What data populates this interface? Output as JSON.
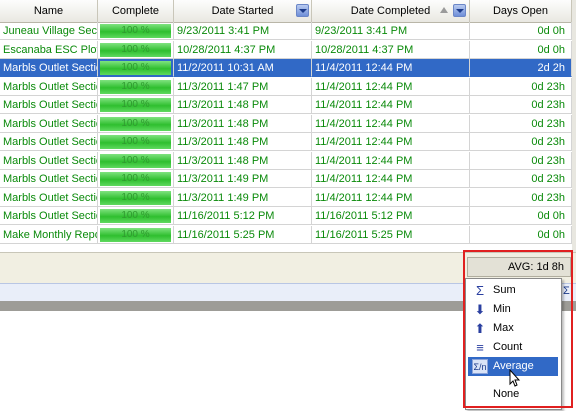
{
  "columns": [
    {
      "label": "Name"
    },
    {
      "label": "Complete"
    },
    {
      "label": "Date Started"
    },
    {
      "label": "Date Completed"
    },
    {
      "label": "Days Open"
    }
  ],
  "rows": [
    {
      "name": "Juneau Village Sect",
      "complete": "100 %",
      "started": "9/23/2011 3:41 PM",
      "completed": "9/23/2011 3:41 PM",
      "days_open": "0d 0h"
    },
    {
      "name": "Escanaba ESC Plot",
      "complete": "100 %",
      "started": "10/28/2011 4:37 PM",
      "completed": "10/28/2011 4:37 PM",
      "days_open": "0d 0h"
    },
    {
      "name": "Marbls Outlet Sectio",
      "complete": "100 %",
      "started": "11/2/2011 10:31 AM",
      "completed": "11/4/2011 12:44 PM",
      "days_open": "2d 2h",
      "selected": true
    },
    {
      "name": "Marbls Outlet Sectio",
      "complete": "100 %",
      "started": "11/3/2011 1:47 PM",
      "completed": "11/4/2011 12:44 PM",
      "days_open": "0d 23h"
    },
    {
      "name": "Marbls Outlet Sectio",
      "complete": "100 %",
      "started": "11/3/2011 1:48 PM",
      "completed": "11/4/2011 12:44 PM",
      "days_open": "0d 23h"
    },
    {
      "name": "Marbls Outlet Sectio",
      "complete": "100 %",
      "started": "11/3/2011 1:48 PM",
      "completed": "11/4/2011 12:44 PM",
      "days_open": "0d 23h"
    },
    {
      "name": "Marbls Outlet Sectio",
      "complete": "100 %",
      "started": "11/3/2011 1:48 PM",
      "completed": "11/4/2011 12:44 PM",
      "days_open": "0d 23h"
    },
    {
      "name": "Marbls Outlet Sectio",
      "complete": "100 %",
      "started": "11/3/2011 1:48 PM",
      "completed": "11/4/2011 12:44 PM",
      "days_open": "0d 23h"
    },
    {
      "name": "Marbls Outlet Sectio",
      "complete": "100 %",
      "started": "11/3/2011 1:49 PM",
      "completed": "11/4/2011 12:44 PM",
      "days_open": "0d 23h"
    },
    {
      "name": "Marbls Outlet Sectio",
      "complete": "100 %",
      "started": "11/3/2011 1:49 PM",
      "completed": "11/4/2011 12:44 PM",
      "days_open": "0d 23h"
    },
    {
      "name": "Marbls Outlet Sectio",
      "complete": "100 %",
      "started": "11/16/2011 5:12 PM",
      "completed": "11/16/2011 5:12 PM",
      "days_open": "0d 0h"
    },
    {
      "name": "Make Monthly Repo",
      "complete": "100 %",
      "started": "11/16/2011 5:25 PM",
      "completed": "11/16/2011 5:25 PM",
      "days_open": "0d 0h"
    }
  ],
  "footer": {
    "avg_label": "AVG: 1d 8h"
  },
  "aggregate_menu": {
    "items": [
      {
        "label": "Sum",
        "icon": "sigma-icon"
      },
      {
        "label": "Min",
        "icon": "min-icon"
      },
      {
        "label": "Max",
        "icon": "max-icon"
      },
      {
        "label": "Count",
        "icon": "count-icon"
      },
      {
        "label": "Average",
        "icon": "average-icon",
        "highlighted": true
      },
      {
        "label": "None",
        "icon": ""
      }
    ]
  },
  "colors": {
    "selection": "#3169c6",
    "row_text": "#0a8a0a",
    "highlight_border": "#e02020",
    "progress": "#2fbf2f"
  }
}
